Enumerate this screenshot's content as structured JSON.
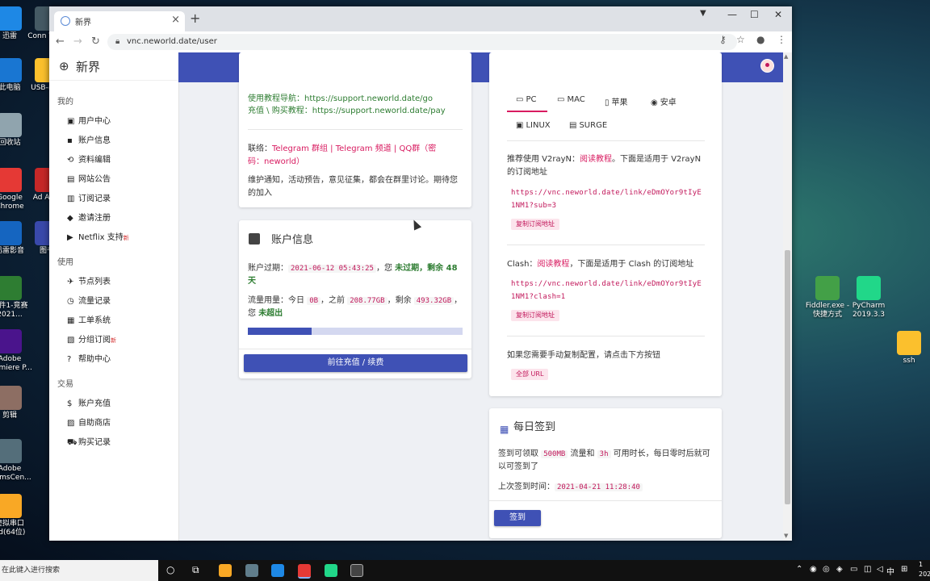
{
  "desktop": {
    "left_icons": [
      {
        "label": "迅雷",
        "color": "#1e88e5"
      },
      {
        "label": "Conn Virtu",
        "color": "#455a64"
      },
      {
        "label": "此电脑",
        "color": "#1976d2"
      },
      {
        "label": "USB-串口",
        "color": "#fbc02d"
      },
      {
        "label": "回收站",
        "color": "#90a4ae"
      },
      {
        "label": "Google Chrome",
        "color": "#e53935"
      },
      {
        "label": "Ad Acro",
        "color": "#c62828"
      },
      {
        "label": "迅雷影音",
        "color": "#1565c0"
      },
      {
        "label": "图书",
        "color": "#3949ab"
      },
      {
        "label": "附件1-竞赛2021...",
        "color": "#2e7d32"
      },
      {
        "label": "Adobe Premiere P...",
        "color": "#4a148c"
      },
      {
        "label": "剪辑",
        "color": "#8d6e63"
      },
      {
        "label": "Adobe FormsCen...",
        "color": "#546e7a"
      },
      {
        "label": "虚拟串口 pd(64位)",
        "color": "#f9a825"
      }
    ],
    "right_icons": [
      {
        "label": "Fiddler.exe - 快捷方式",
        "color": "#43a047"
      },
      {
        "label": "PyCharm 2019.3.3",
        "color": "#21d789"
      },
      {
        "label": "ssh",
        "color": "#fbc02d"
      }
    ]
  },
  "browser": {
    "tab_title": "新界",
    "tab_close": "×",
    "new_tab": "+",
    "url": "vnc.neworld.date/user",
    "controls": {
      "minimize": "—",
      "maximize": "☐",
      "close": "✕"
    }
  },
  "sidebar": {
    "brand": "新界",
    "sections": [
      {
        "title": "我的",
        "items": [
          {
            "icon": "dashboard-icon",
            "glyph": "▣",
            "label": "用户中心",
            "new": false
          },
          {
            "icon": "account-box-icon",
            "glyph": "▪",
            "label": "账户信息",
            "new": false
          },
          {
            "icon": "sync-icon",
            "glyph": "⟲",
            "label": "资料编辑",
            "new": false
          },
          {
            "icon": "announcement-icon",
            "glyph": "▤",
            "label": "网站公告",
            "new": false
          },
          {
            "icon": "receipt-icon",
            "glyph": "▥",
            "label": "订阅记录",
            "new": false
          },
          {
            "icon": "tag-icon",
            "glyph": "◆",
            "label": "邀请注册",
            "new": false
          },
          {
            "icon": "tv-icon",
            "glyph": "▶",
            "label": "Netflix 支持",
            "new": true
          }
        ]
      },
      {
        "title": "使用",
        "items": [
          {
            "icon": "airplane-icon",
            "glyph": "✈",
            "label": "节点列表",
            "new": false
          },
          {
            "icon": "traffic-icon",
            "glyph": "◷",
            "label": "流量记录",
            "new": false
          },
          {
            "icon": "ticket-icon",
            "glyph": "▦",
            "label": "工单系统",
            "new": false
          },
          {
            "icon": "group-subscribe-icon",
            "glyph": "▧",
            "label": "分组订阅",
            "new": true
          },
          {
            "icon": "help-icon",
            "glyph": "?",
            "label": "帮助中心",
            "new": false
          }
        ]
      },
      {
        "title": "交易",
        "items": [
          {
            "icon": "dollar-icon",
            "glyph": "$",
            "label": "账户充值",
            "new": false
          },
          {
            "icon": "shop-icon",
            "glyph": "▨",
            "label": "自助商店",
            "new": false
          },
          {
            "icon": "cart-icon",
            "glyph": "⛟",
            "label": "购买记录",
            "new": false
          }
        ]
      }
    ],
    "new_mark": "新"
  },
  "notice_card": {
    "tutorial_line": "使用教程导航：https://support.neworld.date/go",
    "purchase_line": "充值 \\ 购买教程：https://support.neworld.date/pay",
    "contact_prefix": "联络：",
    "contact_links": "Telegram 群组 | Telegram 频道 | QQ群（密码：neworld）",
    "notice": "维护通知，活动预告，意见征集，都会在群里讨论。期待您的加入"
  },
  "account_card": {
    "title": "账户信息",
    "expire_label": "账户过期：",
    "expire_date": "2021-06-12 05:43:25",
    "expire_status_prefix": "，您 ",
    "expire_status": "未过期，剩余 48 天",
    "usage_label": "流量用量：今日",
    "today": "0B",
    "before_label": "，之前",
    "before": "208.77GB",
    "remain_label": "，剩余",
    "remain": "493.32GB",
    "overuse_prefix": "，您 ",
    "overuse": "未超出",
    "usage_fraction": 0.297,
    "button": "前往充值 / 续费"
  },
  "subscribe_card": {
    "tabs": [
      {
        "icon": "pc-icon",
        "glyph": "▭",
        "label": "PC",
        "active": true
      },
      {
        "icon": "mac-icon",
        "glyph": "▭",
        "label": "MAC",
        "active": false
      },
      {
        "icon": "phone-icon",
        "glyph": "▯",
        "label": "苹果",
        "active": false
      },
      {
        "icon": "android-icon",
        "glyph": "◉",
        "label": "安卓",
        "active": false
      },
      {
        "icon": "linux-icon",
        "glyph": "▣",
        "label": "LINUX",
        "active": false
      },
      {
        "icon": "surge-icon",
        "glyph": "▤",
        "label": "SURGE",
        "active": false
      }
    ],
    "v2ray_prefix": "推荐使用 V2rayN：",
    "v2ray_link": "阅读教程",
    "v2ray_suffix": "。下面是适用于 V2rayN 的订阅地址",
    "v2ray_url": "https://vnc.neworld.date/link/eDmOYor9tIyE1NM1?sub=3",
    "copy_sub": "复制订阅地址",
    "clash_prefix": "Clash：",
    "clash_link": "阅读教程",
    "clash_suffix": "，下面是适用于 Clash 的订阅地址",
    "clash_url": "https://vnc.neworld.date/link/eDmOYor9tIyE1NM1?clash=1",
    "manual": "如果您需要手动复制配置，请点击下方按钮",
    "all_url": "全部 URL"
  },
  "checkin_card": {
    "title": "每日签到",
    "desc_prefix": "签到可领取",
    "traffic": "500MB",
    "desc_mid": "流量和",
    "hours": "3h",
    "desc_suffix": "可用时长，每日零时后就可以可签到了",
    "last_label": "上次签到时间：",
    "last_time": "2021-04-21 11:28:40",
    "button": "签到"
  },
  "taskbar": {
    "search_placeholder": "在此键入进行搜索",
    "tray_text": "中",
    "clock_top": "1",
    "clock_bottom": "202"
  },
  "colors": {
    "primary": "#3f51b5",
    "accent": "#d81b60",
    "green": "#2e7d32"
  }
}
